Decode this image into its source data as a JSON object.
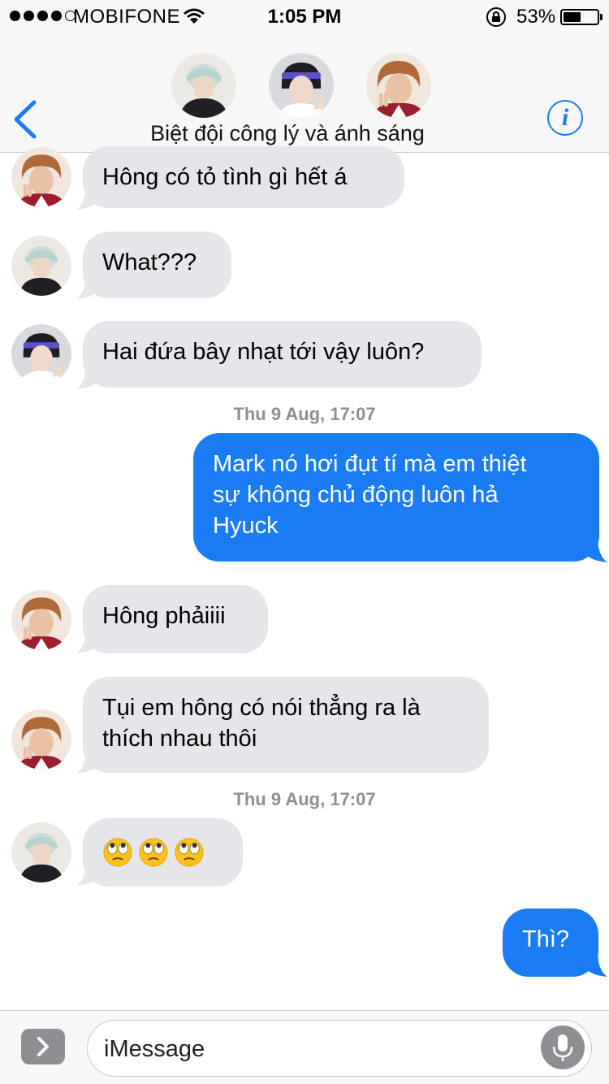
{
  "status_bar": {
    "carrier": "MOBIFONE",
    "time": "1:05 PM",
    "battery_percent": "53%",
    "battery_level": 0.53,
    "signal_bars": 4
  },
  "header": {
    "title": "Biệt đội công lý và ánh sáng",
    "back_icon": "chevron-left-icon",
    "info_icon": "info-icon",
    "info_glyph": "i"
  },
  "messages": [
    {
      "direction": "incoming",
      "sender": "haechan",
      "text": "Hông có tỏ tình gì hết á"
    },
    {
      "direction": "incoming",
      "sender": "jeno",
      "text": "What???"
    },
    {
      "direction": "incoming",
      "sender": "jaemin",
      "text": "Hai đứa bây nhạt tới vậy luôn?"
    },
    {
      "type": "timestamp",
      "text": "Thu 9 Aug, 17:07"
    },
    {
      "direction": "outgoing",
      "lines": [
        "Mark nó hơi đụt tí mà em thiệt",
        "sự không chủ động luôn hả",
        "Hyuck"
      ]
    },
    {
      "direction": "incoming",
      "sender": "haechan",
      "text": "Hông phảiiii"
    },
    {
      "direction": "incoming",
      "sender": "haechan",
      "lines": [
        "Tụi em hông có nói thẳng ra là",
        "thích nhau thôi"
      ]
    },
    {
      "type": "timestamp",
      "text": "Thu 9 Aug, 17:07"
    },
    {
      "direction": "incoming",
      "sender": "jeno",
      "emoji": [
        "face-with-rolling-eyes",
        "face-with-rolling-eyes",
        "face-with-rolling-eyes"
      ]
    },
    {
      "direction": "outgoing",
      "text": "Thì?"
    }
  ],
  "composer": {
    "placeholder": "iMessage",
    "apps_icon": "chevron-right-icon",
    "mic_icon": "microphone-icon"
  },
  "colors": {
    "accent": "#1a7cf5",
    "incoming_bubble": "#e5e5ea",
    "outgoing_bubble": "#1a7cf5",
    "bar_background": "#f7f7f7",
    "timestamp": "#8e8e93"
  }
}
